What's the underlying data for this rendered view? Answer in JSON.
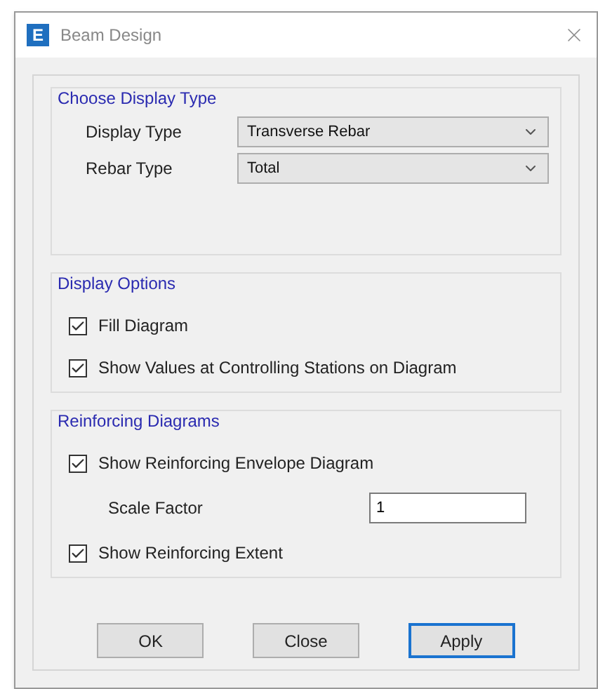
{
  "window": {
    "title": "Beam Design",
    "logo_letter": "E"
  },
  "groups": [
    {
      "title": "Choose Display Type",
      "items": [
        {
          "kind": "dropdown",
          "label": "Display Type",
          "value": "Transverse Rebar"
        },
        {
          "kind": "dropdown",
          "label": "Rebar Type",
          "value": "Total"
        }
      ]
    },
    {
      "title": "Display Options",
      "items": [
        {
          "kind": "checkbox",
          "label": "Fill Diagram",
          "checked": true
        },
        {
          "kind": "checkbox",
          "label": "Show Values at Controlling Stations on Diagram",
          "checked": true
        }
      ]
    },
    {
      "title": "Reinforcing Diagrams",
      "items": [
        {
          "kind": "checkbox",
          "label": "Show Reinforcing Envelope Diagram",
          "checked": true
        },
        {
          "kind": "field",
          "label": "Scale Factor",
          "value": "1"
        },
        {
          "kind": "checkbox",
          "label": "Show Reinforcing Extent",
          "checked": true
        }
      ]
    }
  ],
  "buttons": [
    {
      "label": "OK",
      "default": false
    },
    {
      "label": "Close",
      "default": false
    },
    {
      "label": "Apply",
      "default": true
    }
  ]
}
